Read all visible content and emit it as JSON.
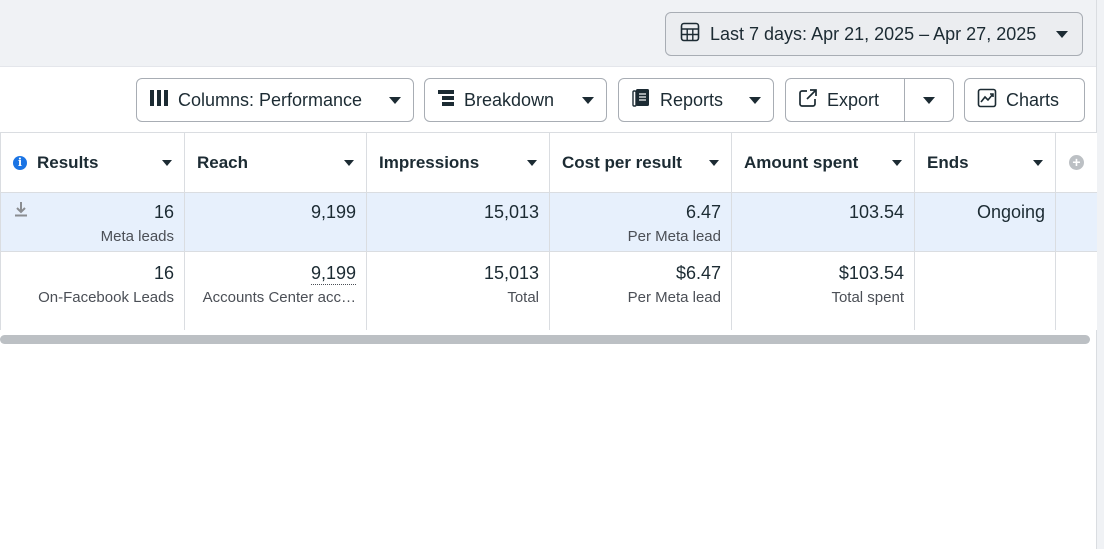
{
  "date_range": {
    "label": "Last 7 days: Apr 21, 2025 – Apr 27, 2025",
    "icon": "calendar-icon"
  },
  "toolbar": {
    "columns_label": "Columns: Performance",
    "breakdown_label": "Breakdown",
    "reports_label": "Reports",
    "export_label": "Export",
    "charts_label": "Charts"
  },
  "table": {
    "headers": [
      "Results",
      "Reach",
      "Impressions",
      "Cost per result",
      "Amount spent",
      "Ends"
    ],
    "row1": {
      "results": {
        "value": "16",
        "sub": "Meta leads"
      },
      "reach": {
        "value": "9,199"
      },
      "impressions": {
        "value": "15,013"
      },
      "cost_per_result": {
        "value": "6.47",
        "sub": "Per Meta lead"
      },
      "amount_spent": {
        "value": "103.54"
      },
      "ends": {
        "value": "Ongoing"
      }
    },
    "row2": {
      "results": {
        "value": "16",
        "sub": "On-Facebook Leads"
      },
      "reach": {
        "value": "9,199",
        "sub": "Accounts Center acc…"
      },
      "impressions": {
        "value": "15,013",
        "sub": "Total"
      },
      "cost_per_result": {
        "value": "$6.47",
        "sub": "Per Meta lead"
      },
      "amount_spent": {
        "value": "$103.54",
        "sub": "Total spent"
      }
    }
  },
  "colors": {
    "accent": "#1b74e4",
    "selected_row": "#e7f0fc",
    "top_band": "#f0f2f5"
  }
}
